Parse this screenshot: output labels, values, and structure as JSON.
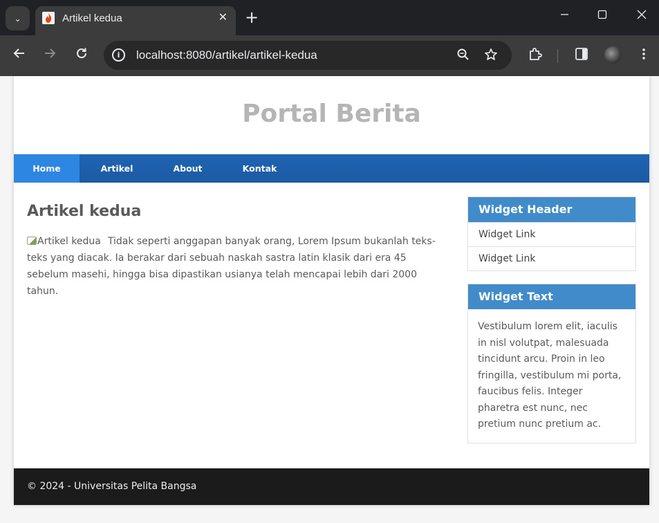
{
  "browser": {
    "tab": {
      "title": "Artikel kedua"
    },
    "new_tab_label": "+",
    "address_bar": {
      "url": "localhost:8080/artikel/artikel-kedua"
    }
  },
  "site": {
    "title": "Portal Berita",
    "nav": [
      {
        "label": "Home",
        "active": true
      },
      {
        "label": "Artikel",
        "active": false
      },
      {
        "label": "About",
        "active": false
      },
      {
        "label": "Kontak",
        "active": false
      }
    ]
  },
  "article": {
    "title": "Artikel kedua",
    "image_alt": "Artikel kedua",
    "body": "Tidak seperti anggapan banyak orang, Lorem Ipsum bukanlah teks-teks yang diacak. Ia berakar dari sebuah naskah sastra latin klasik dari era 45 sebelum masehi, hingga bisa dipastikan usianya telah mencapai lebih dari 2000 tahun."
  },
  "sidebar": {
    "widget_links": {
      "header": "Widget Header",
      "links": [
        "Widget Link",
        "Widget Link"
      ]
    },
    "widget_text": {
      "header": "Widget Text",
      "text": "Vestibulum lorem elit, iaculis in nisl volutpat, malesuada tincidunt arcu. Proin in leo fringilla, vestibulum mi porta, faucibus felis. Integer pharetra est nunc, nec pretium nunc pretium ac."
    }
  },
  "footer": {
    "text": "© 2024 - Universitas Pelita Bangsa"
  },
  "colors": {
    "nav_bar": "#1f64b2",
    "nav_active": "#2e86e3",
    "widget_header": "#428bca",
    "footer_bg": "#1b1b1b",
    "site_title": "#b5b5b5"
  }
}
